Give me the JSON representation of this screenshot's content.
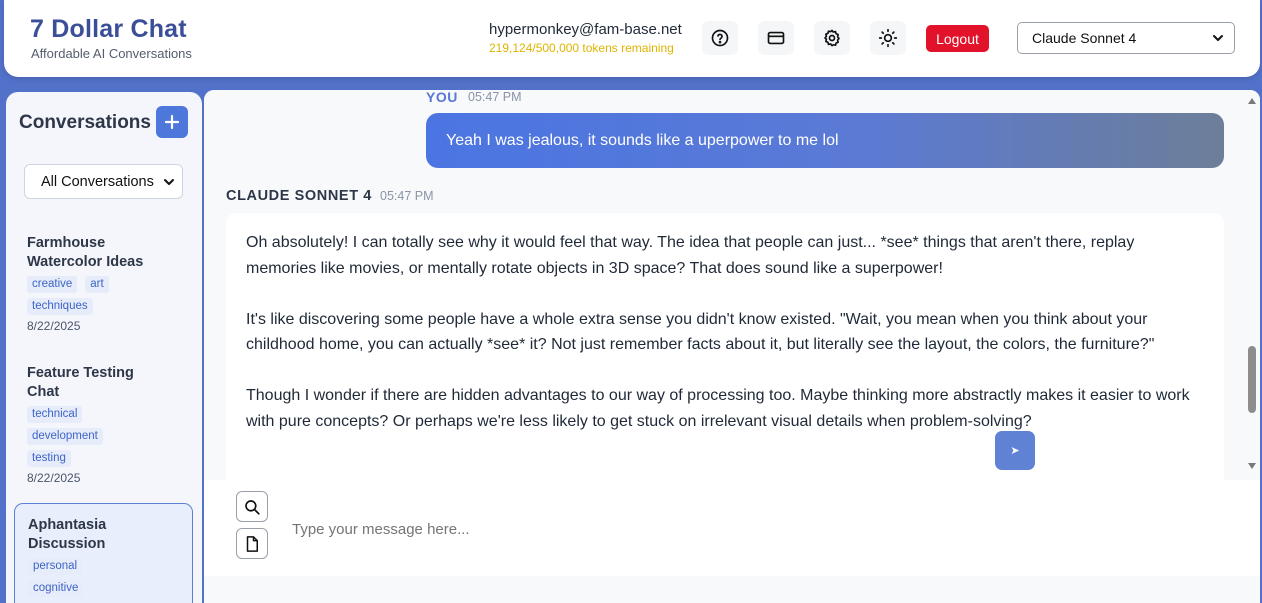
{
  "app": {
    "title": "7 Dollar Chat",
    "subtitle": "Affordable AI Conversations"
  },
  "header": {
    "email": "hypermonkey@fam-base.net",
    "tokens": "219,124/500,000 tokens remaining",
    "logout_label": "Logout",
    "model_selected": "Claude Sonnet 4",
    "icons": [
      "help-icon",
      "billing-card-icon",
      "settings-gear-icon",
      "theme-sun-icon"
    ]
  },
  "sidebar": {
    "title": "Conversations",
    "filter_selected": "All Conversations",
    "conversations": [
      {
        "title": "Farmhouse Watercolor Ideas",
        "tags": [
          "creative",
          "art",
          "techniques"
        ],
        "date": "8/22/2025",
        "active": false
      },
      {
        "title": "Feature Testing Chat",
        "tags": [
          "technical",
          "development",
          "testing"
        ],
        "date": "8/22/2025",
        "active": false
      },
      {
        "title": "Aphantasia Discussion",
        "tags": [
          "personal",
          "cognitive"
        ],
        "date": "",
        "active": true
      }
    ]
  },
  "chat": {
    "user_message": {
      "sender": "YOU",
      "time": "05:47 PM",
      "text": "Yeah I was jealous, it sounds like a uperpower to me lol"
    },
    "ai_message": {
      "sender": "CLAUDE SONNET 4",
      "time": "05:47 PM",
      "paragraphs": [
        "Oh absolutely! I can totally see why it would feel that way. The idea that people can just... *see* things that aren't there, replay memories like movies, or mentally rotate objects in 3D space? That does sound like a superpower!",
        "It's like discovering some people have a whole extra sense you didn't know existed. \"Wait, you mean when you think about your childhood home, you can actually *see* it? Not just remember facts about it, but literally see the layout, the colors, the furniture?\"",
        "Though I wonder if there are hidden advantages to our way of processing too. Maybe thinking more abstractly makes it easier to work with pure concepts? Or perhaps we're less likely to get stuck on irrelevant visual details when problem-solving?"
      ]
    },
    "input": {
      "placeholder": "Type your message here...",
      "value": "",
      "send_glyph": "➤"
    }
  },
  "colors": {
    "brand": "#3b4f99",
    "accent": "#4e77db",
    "logout": "#e3122b",
    "tokens": "#e0b400"
  }
}
